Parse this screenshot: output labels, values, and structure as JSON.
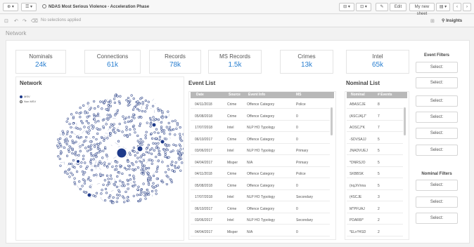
{
  "toolbar": {
    "app_title": "NDAS Most Serious Violence - Acceleration Phase",
    "edit_label": "Edit",
    "sheet_label": "My new sheet"
  },
  "selections": {
    "status": "No selections applied",
    "insights_label": "Insights"
  },
  "sheet": {
    "title": "Network"
  },
  "kpis": [
    {
      "label": "Nominals",
      "value": "24k"
    },
    {
      "label": "Connections",
      "value": "61k"
    },
    {
      "label": "Records",
      "value": "78k"
    },
    {
      "label": "MS Records",
      "value": "1.5k"
    },
    {
      "label": "Crimes",
      "value": "13k"
    },
    {
      "label": "Intel",
      "value": "65k"
    }
  ],
  "network": {
    "title": "Network",
    "legend": [
      {
        "label": "MSV",
        "color": "#1e3a8a"
      },
      {
        "label": "Non MSV",
        "color": "#ffffff"
      }
    ],
    "colors": {
      "node": "#3a4f8f",
      "node_fill": "#ffffff",
      "hub": "#1e3a8a"
    }
  },
  "event_list": {
    "title": "Event List",
    "columns": [
      "Date",
      "Source",
      "Event Info",
      "MS"
    ],
    "rows": [
      [
        "04/11/2018",
        "Crime",
        "Offence Category",
        "Police"
      ],
      [
        "05/08/2018",
        "Crime",
        "Offence Category",
        "0"
      ],
      [
        "17/07/2018",
        "Intel",
        "NLP HO Typology",
        "0"
      ],
      [
        "06/10/2017",
        "Crime",
        "Offence Category",
        "0"
      ],
      [
        "03/06/2017",
        "Intel",
        "NLP HO Typology",
        "Primary"
      ],
      [
        "04/04/2017",
        "Misper",
        "N/A",
        "Primary"
      ],
      [
        "04/11/2018",
        "Crime",
        "Offence Category",
        "Police"
      ],
      [
        "05/08/2018",
        "Crime",
        "Offence Category",
        "0"
      ],
      [
        "17/07/2018",
        "Intel",
        "NLP HO Typology",
        "Secondary"
      ],
      [
        "06/10/2017",
        "Crime",
        "Offence Category",
        "0"
      ],
      [
        "03/06/2017",
        "Intel",
        "NLP HO Typology",
        "Secondary"
      ],
      [
        "04/04/2017",
        "Misper",
        "N/A",
        "0"
      ]
    ]
  },
  "nominal_list": {
    "title": "Nominal List",
    "columns": [
      "Nominal",
      "# Events"
    ],
    "rows": [
      [
        "ABASCJE",
        "8"
      ],
      [
        "(ASCJA}J\"",
        "7"
      ],
      [
        "AOSCJ*K",
        "7"
      ],
      [
        "-SDVSAJJ",
        "5"
      ],
      [
        "JNADVUEJ",
        "5"
      ],
      [
        "*DNRSJO",
        "5"
      ],
      [
        "SKBBSK",
        "5"
      ],
      [
        "(nqJrVnna",
        "5"
      ],
      [
        "(4SCJE",
        "3"
      ],
      [
        "M\"PFUAJ",
        "2"
      ],
      [
        "PDAR8/*",
        "2"
      ],
      [
        "*ELn*HSD",
        "2"
      ]
    ]
  },
  "filters": {
    "event_title": "Event Filters",
    "nominal_title": "Nominal Filters",
    "event_selects": [
      "Select:",
      "Select:",
      "Select:",
      "Select:",
      "Select:",
      "Select:"
    ],
    "nominal_selects": [
      "Select:",
      "Select:",
      "Select:"
    ]
  }
}
